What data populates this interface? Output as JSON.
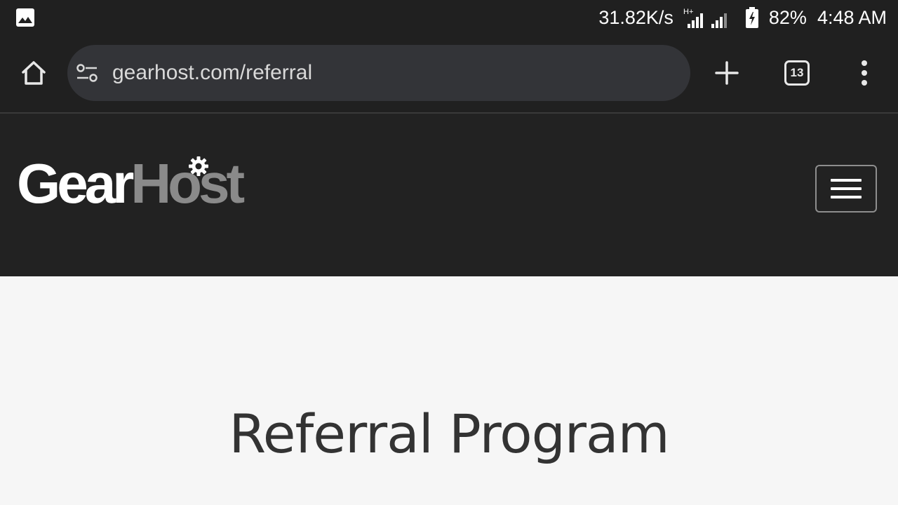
{
  "status_bar": {
    "left_icon": "image-icon",
    "net_speed": "31.82K/s",
    "network_type": "H+",
    "battery_percent": "82%",
    "time": "4:48 AM"
  },
  "browser": {
    "url": "gearhost.com/referral",
    "tab_count": "13",
    "icons": {
      "home": "home-icon",
      "site_settings": "tune-icon",
      "new_tab": "plus-icon",
      "tabs": "tab-switcher-icon",
      "menu": "more-vert-icon"
    }
  },
  "site": {
    "logo": {
      "part1": "Gear",
      "part2": "Host",
      "colors": {
        "gear": "#ffffff",
        "host": "#8a8a8a"
      }
    },
    "menu_icon": "hamburger-icon",
    "header_bg": "#222222"
  },
  "main": {
    "title": "Referral Program"
  }
}
